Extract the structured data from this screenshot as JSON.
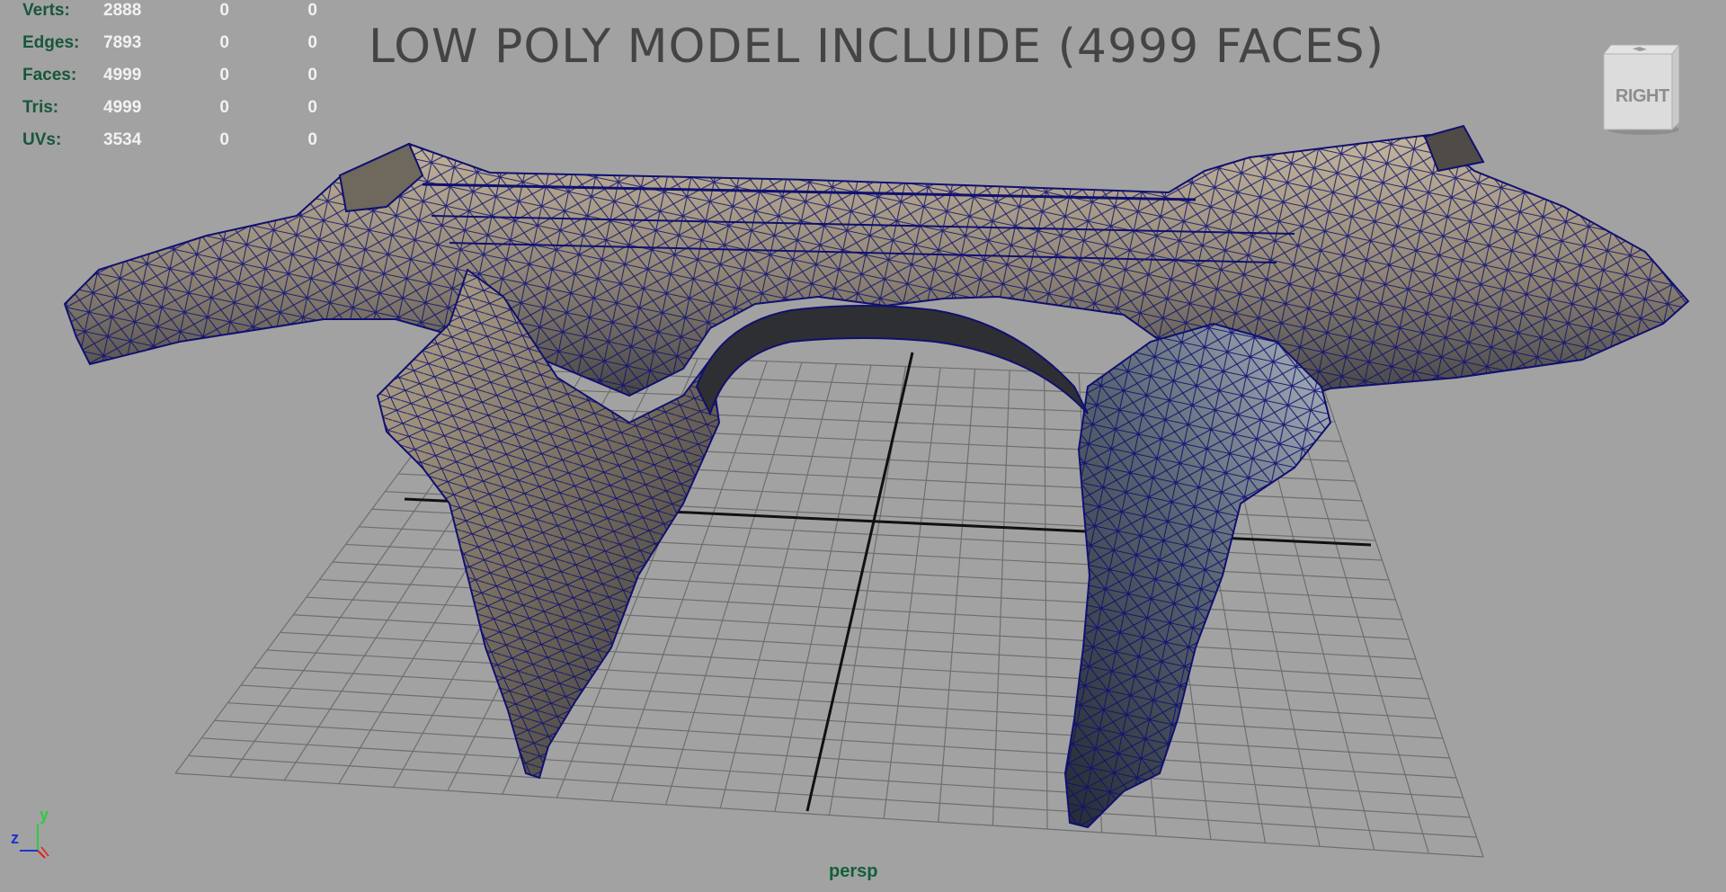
{
  "title": "LOW POLY MODEL INCLUIDE (4999 FACES)",
  "stats": [
    {
      "label": "Verts:",
      "v0": "2888",
      "v1": "0",
      "v2": "0"
    },
    {
      "label": "Edges:",
      "v0": "7893",
      "v1": "0",
      "v2": "0"
    },
    {
      "label": "Faces:",
      "v0": "4999",
      "v1": "0",
      "v2": "0"
    },
    {
      "label": "Tris:",
      "v0": "4999",
      "v1": "0",
      "v2": "0"
    },
    {
      "label": "UVs:",
      "v0": "3534",
      "v1": "0",
      "v2": "0"
    }
  ],
  "viewcube": {
    "face": "RIGHT",
    "icon": "viewcube-icon"
  },
  "camera": "persp",
  "axis": {
    "y": "y",
    "z": "z"
  },
  "colors": {
    "background": "#a2a2a2",
    "wire": "#0d0d6e",
    "stone_light": "#b8ab92",
    "stone_dark": "#3a3b40",
    "hud_label": "#16573a",
    "hud_value": "#f2f2f2",
    "title": "#444444"
  }
}
